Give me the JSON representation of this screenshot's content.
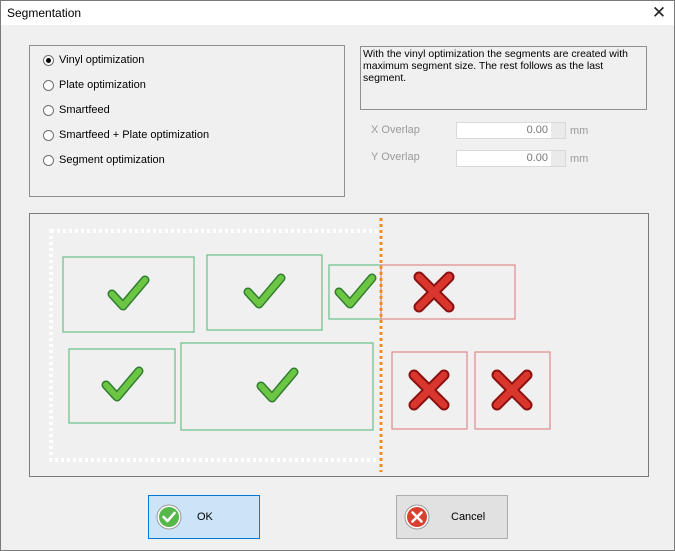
{
  "window": {
    "title": "Segmentation",
    "close_glyph": "✕"
  },
  "options": [
    {
      "label": "Vinyl optimization",
      "checked": true
    },
    {
      "label": "Plate optimization",
      "checked": false
    },
    {
      "label": "Smartfeed",
      "checked": false
    },
    {
      "label": "Smartfeed + Plate optimization",
      "checked": false
    },
    {
      "label": "Segment optimization",
      "checked": false
    }
  ],
  "description": "With the vinyl optimization the segments are created with maximum segment size. The rest follows as the last segment.",
  "overlap": {
    "x": {
      "label": "X Overlap",
      "value": "0.00",
      "unit": "mm"
    },
    "y": {
      "label": "Y Overlap",
      "value": "0.00",
      "unit": "mm"
    }
  },
  "buttons": {
    "ok": "OK",
    "cancel": "Cancel"
  },
  "colors": {
    "accept": "#5cb85c",
    "reject": "#c9302c",
    "segment_line": "#f08a24",
    "ok_bg": "#cce4f7",
    "ok_border": "#0078d7"
  },
  "icons": {
    "accept": "check-icon",
    "reject": "cross-icon",
    "ok": "ok-check-icon",
    "cancel": "cancel-cross-icon"
  }
}
